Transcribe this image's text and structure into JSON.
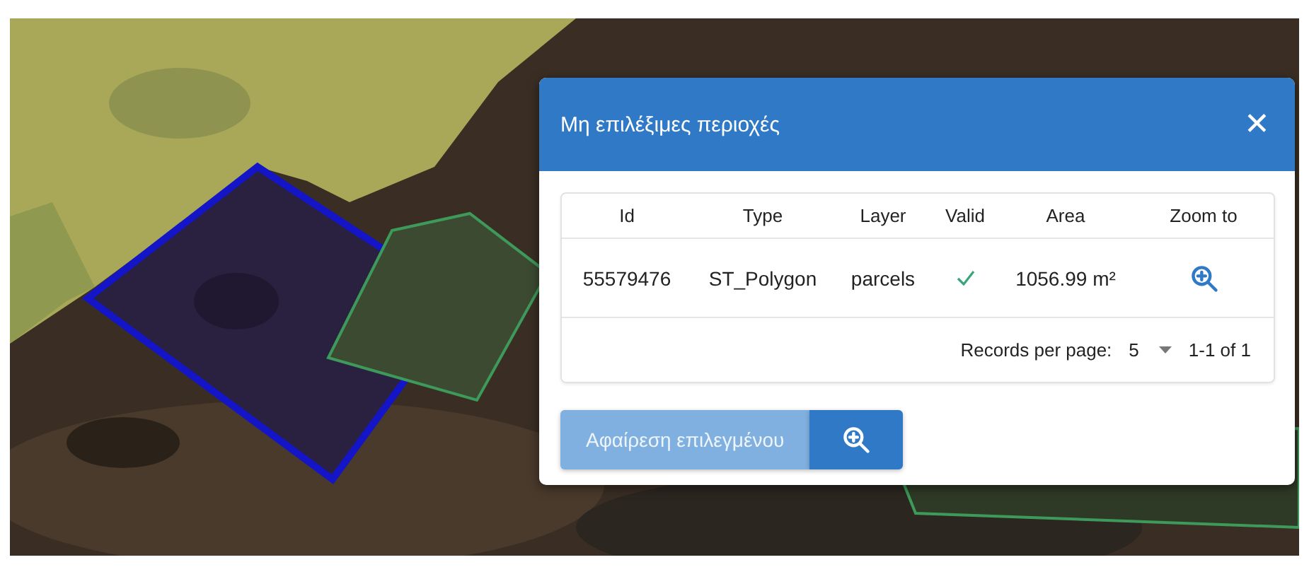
{
  "dialog": {
    "title": "Μη επιλέξιμες περιοχές",
    "close_label": "✕",
    "table": {
      "columns": [
        "Id",
        "Type",
        "Layer",
        "Valid",
        "Area",
        "Zoom to"
      ],
      "rows": [
        {
          "id": "55579476",
          "type": "ST_Polygon",
          "layer": "parcels",
          "valid": true,
          "area": "1056.99 m²"
        }
      ],
      "records_label": "Records per page:",
      "records_value": "5",
      "range": "1-1 of 1"
    },
    "remove_button": {
      "label": "Αφαίρεση επιλεγμένου",
      "disabled": true
    }
  }
}
